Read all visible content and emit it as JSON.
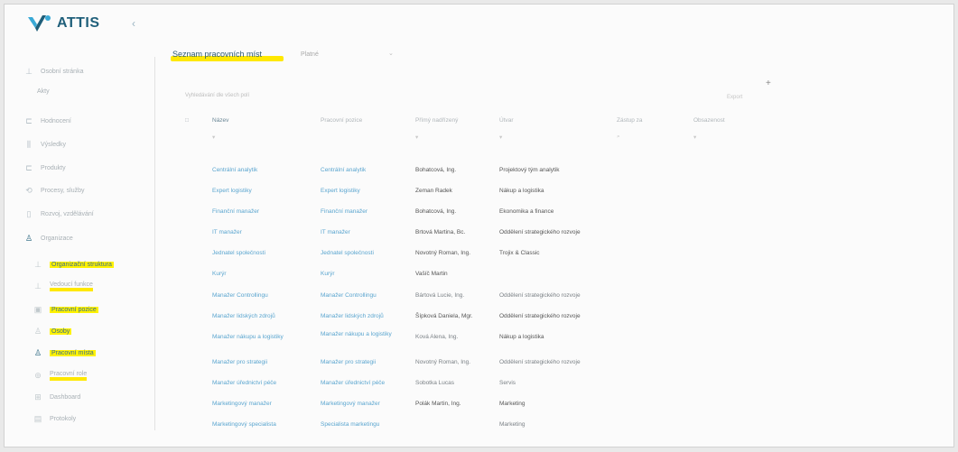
{
  "app": {
    "brand": "ATTIS",
    "collapse_icon": "chevron-left-icon"
  },
  "sidebar": {
    "items": [
      {
        "label": "Osobní stránka",
        "icon": "user-icon"
      },
      {
        "label": "Akty",
        "icon": ""
      },
      {
        "label": "Hodnocení",
        "icon": "chart-icon"
      },
      {
        "label": "Výsledky",
        "icon": "chart-bars-icon"
      },
      {
        "label": "Produkty",
        "icon": "list-icon"
      },
      {
        "label": "Procesy, služby",
        "icon": "process-icon"
      },
      {
        "label": "Rozvoj, vzdělávání",
        "icon": "book-icon"
      },
      {
        "label": "Organizace",
        "icon": "org-icon"
      },
      {
        "label": "Organizační struktura",
        "icon": "org-icon",
        "highlight": true
      },
      {
        "label": "Vedoucí funkce",
        "icon": "person-icon",
        "highlight": true
      },
      {
        "label": "Pracovní pozice",
        "icon": "briefcase-icon",
        "highlight": true
      },
      {
        "label": "Osoby",
        "icon": "person-icon",
        "highlight": true
      },
      {
        "label": "Pracovní místa",
        "icon": "org-icon",
        "highlight": true
      },
      {
        "label": "Pracovní role",
        "icon": "role-icon",
        "highlight": true
      },
      {
        "label": "Dashboard",
        "icon": "grid-icon"
      },
      {
        "label": "Protokoly",
        "icon": "doc-icon"
      }
    ]
  },
  "page": {
    "title": "Seznam pracovních míst",
    "filter_label": "Platné",
    "search_placeholder": "Vyhledávání dle všech polí",
    "export_label": "Export"
  },
  "table": {
    "headers": [
      "Název",
      "Pracovní pozice",
      "Přímý nadřízený",
      "Útvar",
      "Zástup za",
      "Obsazenost"
    ],
    "filter_row": [
      "",
      "",
      "",
      "",
      "",
      ""
    ],
    "rows": [
      [
        "Centrální analytik",
        "Centrální analytik",
        "Bohatcová, Ing.",
        "Projektový tým analytik"
      ],
      [
        "Expert logistiky",
        "Expert logistiky",
        "Zeman Radek",
        "Nákup a logistika"
      ],
      [
        "Finanční manažer",
        "Finanční manažer",
        "Bohatcová, Ing.",
        "Ekonomika a finance"
      ],
      [
        "IT manažer",
        "IT manažer",
        "Brtová Martina, Bc.",
        "Oddělení strategického rozvoje"
      ],
      [
        "Jednatel společnosti",
        "Jednatel společnosti",
        "Novotný Roman, Ing.",
        "Trojix & Classic"
      ],
      [
        "Kurýr",
        "Kurýr",
        "Vašíč Martin",
        ""
      ],
      [
        "Manažer Controllingu",
        "Manažer Controllingu",
        "Bártová Lucie, Ing.",
        "Oddělení strategického rozvoje"
      ],
      [
        "Manažer lidských zdrojů",
        "Manažer lidských zdrojů",
        "Šípková Daniela, Mgr.",
        "Oddělení strategického rozvoje"
      ],
      [
        "Manažer nákupu a logistiky",
        "Manažer nákupu a logistiky",
        "Ková Alena, Ing.",
        "Nákup a logistika"
      ],
      [
        "Manažer pro strategii",
        "Manažer pro strategii",
        "Novotný Roman, Ing.",
        "Oddělení strategického rozvoje"
      ],
      [
        "Manažer úřednictví péče",
        "Manažer úřednictví péče",
        "Sobotka Lucas",
        "Servis"
      ],
      [
        "Marketingový manažer",
        "Marketingový manažer",
        "Polák Martin, Ing.",
        "Marketing"
      ],
      [
        "Marketingový specialista",
        "Specialista marketingu",
        "",
        "Marketing"
      ]
    ]
  }
}
